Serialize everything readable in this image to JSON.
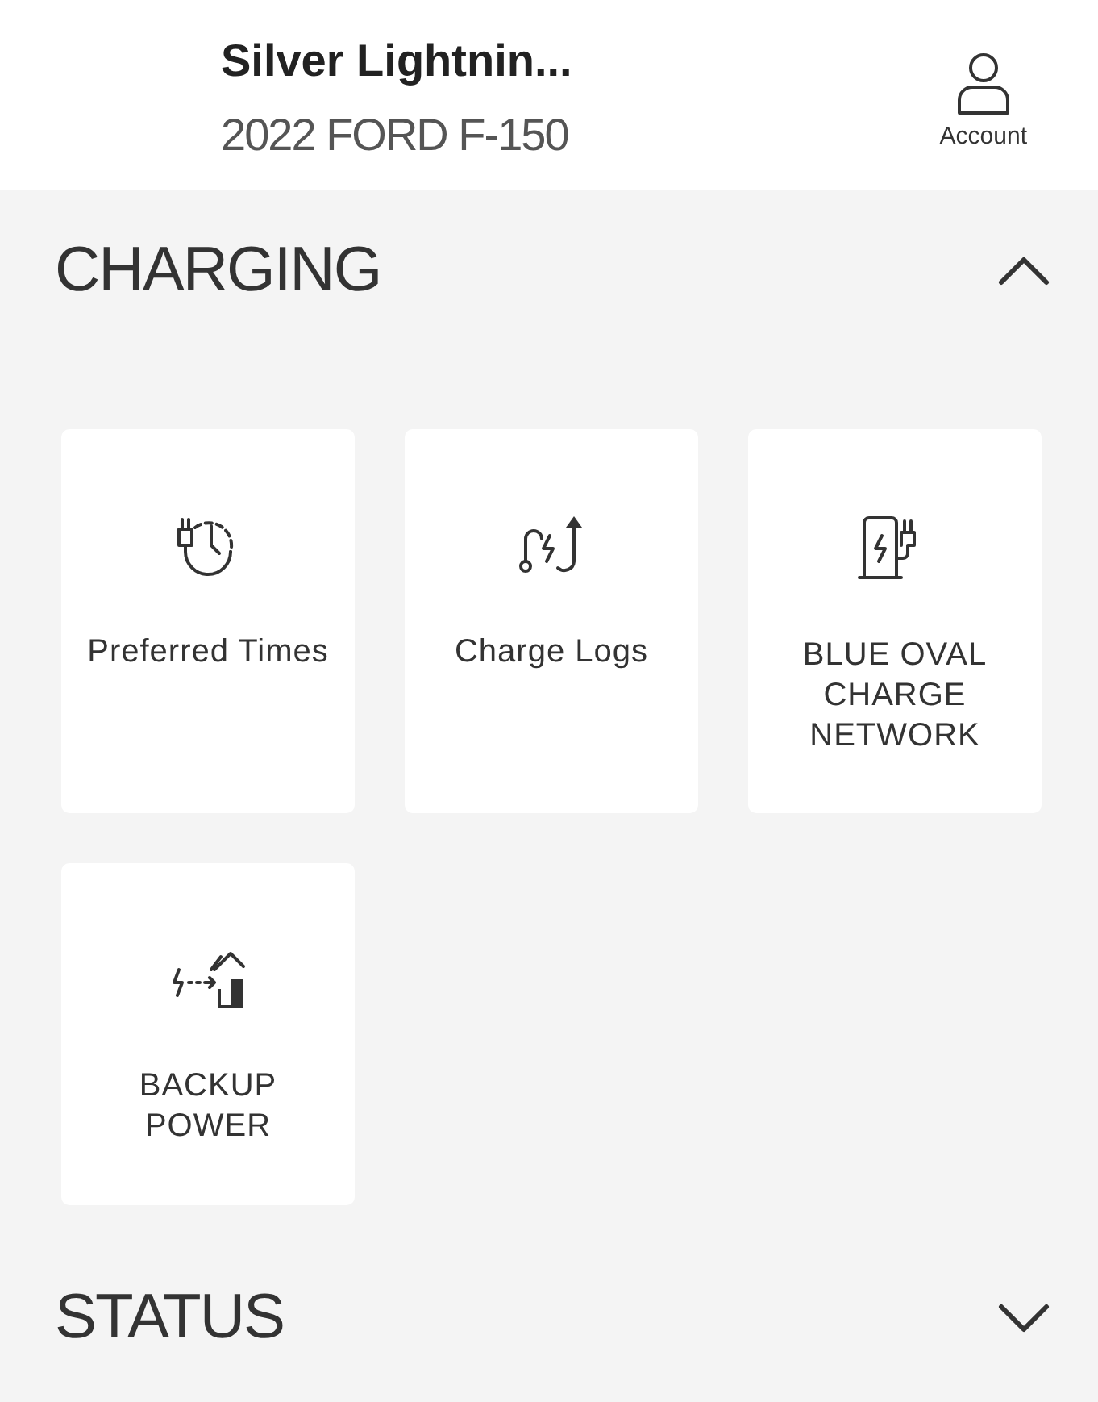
{
  "header": {
    "vehicle_name": "Silver Lightnin...",
    "vehicle_model": "2022 FORD F-150",
    "account_label": "Account"
  },
  "sections": [
    {
      "title": "CHARGING",
      "expanded": true,
      "tiles": [
        {
          "label": "Preferred Times"
        },
        {
          "label": "Charge Logs"
        },
        {
          "label": "BLUE OVAL CHARGE NETWORK"
        },
        {
          "label": "BACKUP POWER"
        }
      ]
    },
    {
      "title": "STATUS",
      "expanded": false
    }
  ]
}
